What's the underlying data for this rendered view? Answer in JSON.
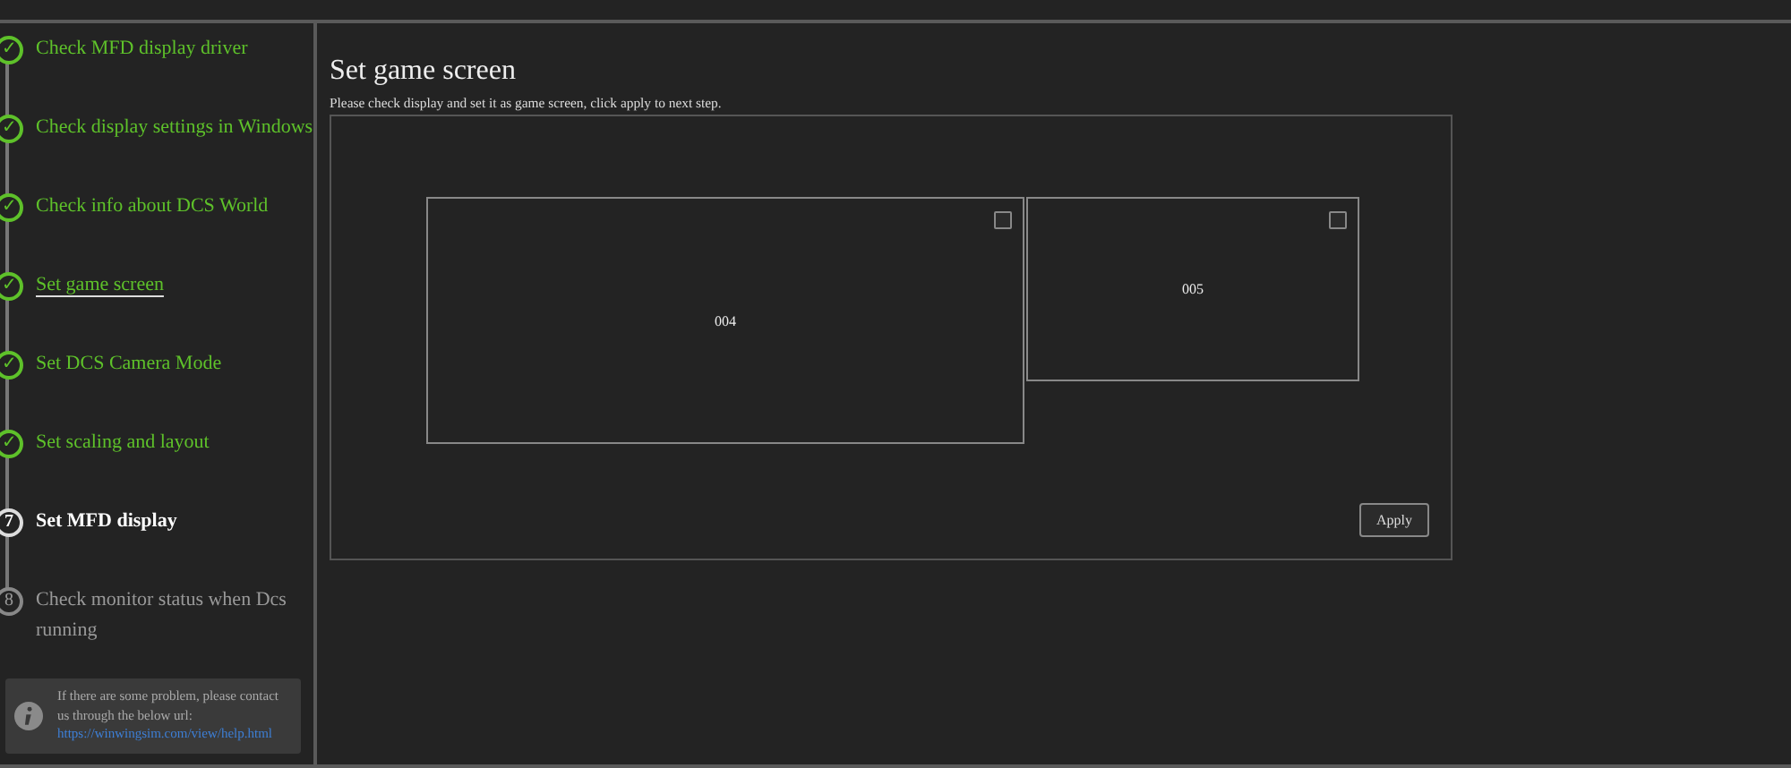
{
  "steps": [
    {
      "marker": "✓",
      "label": "Check MFD display driver",
      "kind": "done",
      "selected": false
    },
    {
      "marker": "✓",
      "label": "Check display settings in Windows",
      "kind": "done",
      "selected": false
    },
    {
      "marker": "✓",
      "label": "Check info about DCS World",
      "kind": "done",
      "selected": false
    },
    {
      "marker": "✓",
      "label": "Set game screen",
      "kind": "done",
      "selected": true
    },
    {
      "marker": "✓",
      "label": "Set DCS Camera Mode",
      "kind": "done",
      "selected": false
    },
    {
      "marker": "✓",
      "label": "Set scaling and layout",
      "kind": "done",
      "selected": false
    },
    {
      "marker": "7",
      "label": "Set MFD display",
      "kind": "current",
      "selected": false
    },
    {
      "marker": "8",
      "label": "Check monitor status when Dcs running",
      "kind": "pending",
      "selected": false
    }
  ],
  "help": {
    "text": "If there are some problem, please contact us through the below url:",
    "link": "https://winwingsim.com/view/help.html"
  },
  "title": "Set game screen",
  "description": "Please check display and set it as game screen, click apply to next step.",
  "monitors": [
    {
      "label": "004",
      "checked": false,
      "kind": "large"
    },
    {
      "label": "005",
      "checked": false,
      "kind": "small"
    }
  ],
  "apply": "Apply"
}
